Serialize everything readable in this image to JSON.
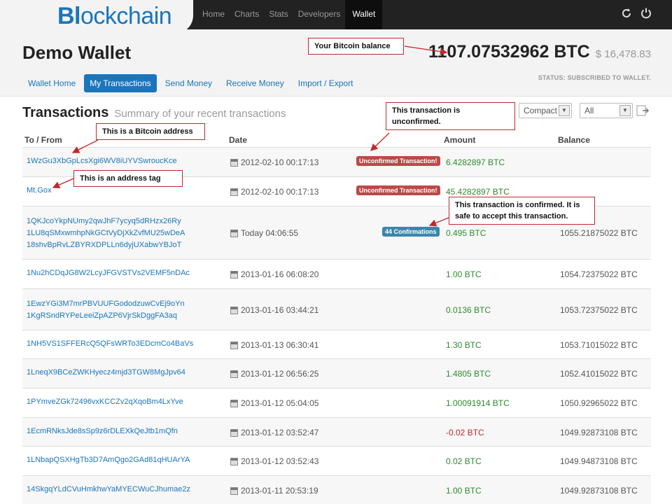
{
  "logo": {
    "part1": "Bl",
    "part2": "ckchain",
    "text": "Blockchain"
  },
  "nav": {
    "items": [
      "Home",
      "Charts",
      "Stats",
      "Developers",
      "Wallet"
    ],
    "active": "Wallet"
  },
  "nav_icons": [
    "refresh-icon",
    "power-icon"
  ],
  "wallet": {
    "title": "Demo Wallet",
    "balance_btc": "1107.07532962 BTC",
    "balance_usd": "$ 16,478.83",
    "status": "STATUS: SUBSCRIBED TO WALLET."
  },
  "tabs": [
    {
      "label": "Wallet Home"
    },
    {
      "label": "My Transactions",
      "active": true
    },
    {
      "label": "Send Money"
    },
    {
      "label": "Receive Money"
    },
    {
      "label": "Import / Export"
    }
  ],
  "section": {
    "title": "Transactions",
    "subtitle": "Summary of your recent transactions",
    "view_filter": "Compact",
    "type_filter": "All"
  },
  "columns": {
    "to_from": "To / From",
    "date": "Date",
    "amount": "Amount",
    "balance": "Balance"
  },
  "transactions": [
    {
      "addresses": [
        "1WzGu3XbGpLcsXgi6WV8iUYVSwroucKce"
      ],
      "date": "2012-02-10 00:17:13",
      "status": "Unconfirmed Transaction!",
      "amount": "6.4282897 BTC",
      "balance": ""
    },
    {
      "addresses": [
        "Mt.Gox"
      ],
      "date": "2012-02-10 00:17:13",
      "status": "Unconfirmed Transaction!",
      "amount": "45.4282897 BTC",
      "balance": ""
    },
    {
      "addresses": [
        "1QKJcoYkpNUmy2qwJhF7ycyq5dRHzx26Ry",
        "1LU8qSMxwmhpNkGCtVyDjXkZvfMU25wDeA",
        "18shvBpRvLZBYRXDPLLn6dyjUXabwYBJoT"
      ],
      "date": "Today 04:06:55",
      "status": "44 Confirmations",
      "amount": "0.495 BTC",
      "balance": "1055.21875022 BTC"
    },
    {
      "addresses": [
        "1Nu2hCDqJG8W2LcyJFGVSTVs2VEMF5nDAc"
      ],
      "date": "2013-01-16 06:08:20",
      "status": "",
      "amount": "1.00 BTC",
      "balance": "1054.72375022 BTC"
    },
    {
      "addresses": [
        "1EwzYGi3M7mrPBVUUFGododzuwCvEj9oYn",
        "1KgRSndRYPeLeeiZpAZP6VjrSkDggFA3aq"
      ],
      "date": "2013-01-16 03:44:21",
      "status": "",
      "amount": "0.0136 BTC",
      "balance": "1053.72375022 BTC"
    },
    {
      "addresses": [
        "1NH5VS1SFFERcQ5QFsWRTo3EDcmCo4BaVs"
      ],
      "date": "2013-01-13 06:30:41",
      "status": "",
      "amount": "1.30 BTC",
      "balance": "1053.71015022 BTC"
    },
    {
      "addresses": [
        "1LneqX9BCeZWKHyecz4mjd3TGW8MgJpv64"
      ],
      "date": "2013-01-12 06:56:25",
      "status": "",
      "amount": "1.4805 BTC",
      "balance": "1052.41015022 BTC"
    },
    {
      "addresses": [
        "1PYmveZGk72496vxKCCZv2qXqoBm4LxYve"
      ],
      "date": "2013-01-12 05:04:05",
      "status": "",
      "amount": "1.00091914 BTC",
      "balance": "1050.92965022 BTC"
    },
    {
      "addresses": [
        "1EcmRNksJde8sSp9z6rDLEXkQeJtb1mQfn"
      ],
      "date": "2013-01-12 03:52:47",
      "status": "",
      "amount": "-0.02 BTC",
      "balance": "1049.92873108 BTC"
    },
    {
      "addresses": [
        "1LNbapQSXHgTb3D7AmQgo2GAd81qHUArYA"
      ],
      "date": "2013-01-12 03:52:43",
      "status": "",
      "amount": "0.02 BTC",
      "balance": "1049.94873108 BTC"
    },
    {
      "addresses": [
        "14SkgqYLdCVuHmkhwYaMYECWuCJhumae2z"
      ],
      "date": "2013-01-11 20:53:19",
      "status": "",
      "amount": "1.00 BTC",
      "balance": "1049.92873108 BTC"
    }
  ],
  "annotations": {
    "balance_note": "Your Bitcoin balance",
    "address_note": "This is a Bitcoin address",
    "tag_note": "This is an address tag",
    "unconfirmed_note": "This transaction is unconfirmed.",
    "confirmed_note": "This transaction is confirmed. It is safe to accept this transaction."
  },
  "colors": {
    "brand": "#1b75bb",
    "positive": "#2e8b2e",
    "negative": "#c0282e",
    "unconfirmed_badge": "#b94a48",
    "confirmed_badge": "#3a87ad"
  }
}
